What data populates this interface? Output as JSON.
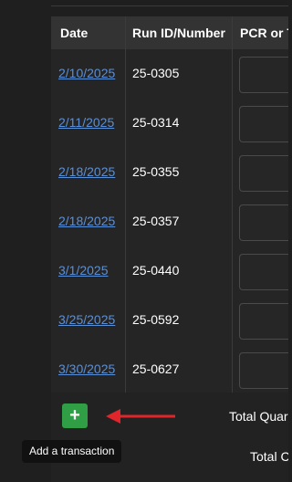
{
  "table": {
    "headers": [
      "Date",
      "Run ID/Number",
      "PCR or T"
    ],
    "rows": [
      {
        "date": "2/10/2025",
        "run_id": "25-0305"
      },
      {
        "date": "2/11/2025",
        "run_id": "25-0314"
      },
      {
        "date": "2/18/2025",
        "run_id": "25-0355"
      },
      {
        "date": "2/18/2025",
        "run_id": "25-0357"
      },
      {
        "date": "3/1/2025",
        "run_id": "25-0440"
      },
      {
        "date": "3/25/2025",
        "run_id": "25-0592"
      },
      {
        "date": "3/30/2025",
        "run_id": "25-0627"
      }
    ]
  },
  "footer": {
    "add_button_symbol": "+",
    "total_quantity_label": "Total Quar",
    "total_label": "Total C"
  },
  "tooltip": {
    "text": "Add a transaction"
  },
  "colors": {
    "link": "#5b8fd6",
    "add_button": "#2f9e44",
    "arrow": "#e0262b"
  },
  "icons": {
    "add": "plus-icon",
    "annotation": "red-arrow-icon"
  }
}
